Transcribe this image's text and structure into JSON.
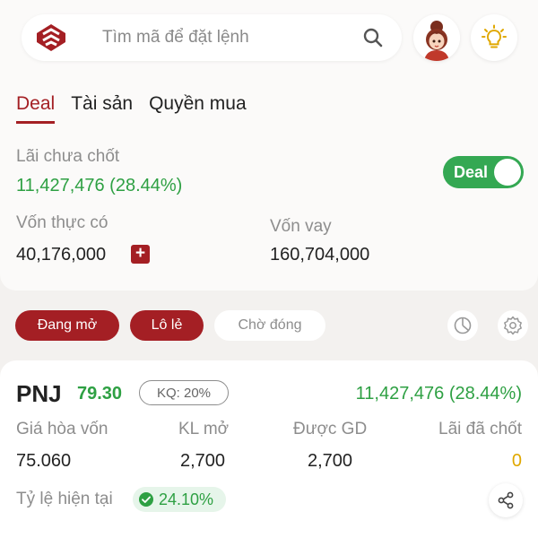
{
  "search": {
    "placeholder": "Tìm mã để đặt lệnh"
  },
  "tabs": [
    {
      "label": "Deal",
      "active": true
    },
    {
      "label": "Tài sản",
      "active": false
    },
    {
      "label": "Quyền mua",
      "active": false
    }
  ],
  "summary": {
    "unrealized_label": "Lãi chưa chốt",
    "unrealized_value": "11,427,476 (28.44%)",
    "toggle_label": "Deal",
    "toggle_on": true,
    "equity_label": "Vốn thực có",
    "equity_value": "40,176,000",
    "equity_add_symbol": "+",
    "loan_label": "Vốn vay",
    "loan_value": "160,704,000"
  },
  "filters": [
    {
      "label": "Đang mở",
      "active": true
    },
    {
      "label": "Lô lẻ",
      "active": true
    },
    {
      "label": "Chờ đóng",
      "active": false
    }
  ],
  "position": {
    "ticker": "PNJ",
    "price": "79.30",
    "kq_badge": "KQ: 20%",
    "pnl": "11,427,476 (28.44%)",
    "columns": [
      {
        "label": "Giá hòa vốn",
        "value": "75.060"
      },
      {
        "label": "KL mở",
        "value": "2,700"
      },
      {
        "label": "Được GD",
        "value": "2,700"
      },
      {
        "label": "Lãi đã chốt",
        "value": "0"
      }
    ],
    "ratio_label": "Tỷ lệ hiện tại",
    "ratio_value": "24.10%"
  },
  "colors": {
    "brand": "#a41f24",
    "positive": "#2ea043",
    "zero_value": "#e0a800",
    "toggle": "#34a853"
  },
  "icons": {
    "logo": "brand-logo-icon",
    "search": "search-icon",
    "avatar": "avatar",
    "idea": "lightbulb-icon",
    "chart": "pie-chart-icon",
    "settings": "gear-icon",
    "share": "share-icon",
    "check": "check-circle-icon"
  }
}
